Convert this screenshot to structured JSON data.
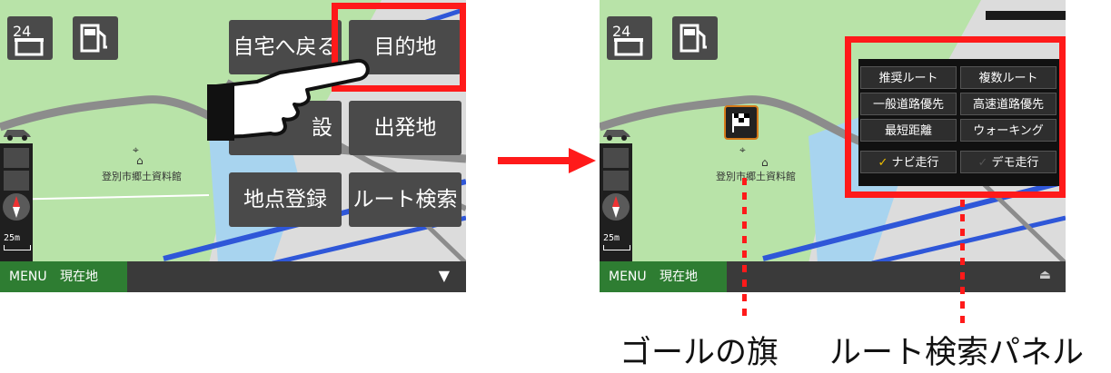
{
  "screen1": {
    "map_label": "登別市郷土資料館",
    "scale": "25m",
    "menu_buttons": {
      "home": "自宅へ戻る",
      "destination": "目的地",
      "facility": "設",
      "departure": "出発地",
      "register_point": "地点登録",
      "route_search": "ルート検索"
    },
    "bottom": {
      "menu": "MENU",
      "current_location": "現在地"
    }
  },
  "screen2": {
    "map_label": "登別市郷土資料館",
    "scale": "25m",
    "route_panel": {
      "recommended": "推奨ルート",
      "multiple": "複数ルート",
      "general_road": "一般道路優先",
      "highway": "高速道路優先",
      "shortest": "最短距離",
      "walking": "ウォーキング",
      "navi_drive": "ナビ走行",
      "demo_drive": "デモ走行"
    },
    "bottom": {
      "menu": "MENU",
      "current_location": "現在地"
    }
  },
  "captions": {
    "goal_flag": "ゴールの旗",
    "route_panel": "ルート検索パネル"
  },
  "colors": {
    "highlight": "#ff1a1a",
    "panel_bg": "#111111",
    "button_bg": "#4a4a4a",
    "map_green": "#b8e3a8",
    "water": "#a8d4ef"
  },
  "icons": [
    "convenience-store-24-icon",
    "gas-station-icon",
    "car-icon",
    "compass-icon",
    "museum-icon",
    "pointing-hand-icon",
    "checkered-flag-icon",
    "arrow-right-icon"
  ]
}
